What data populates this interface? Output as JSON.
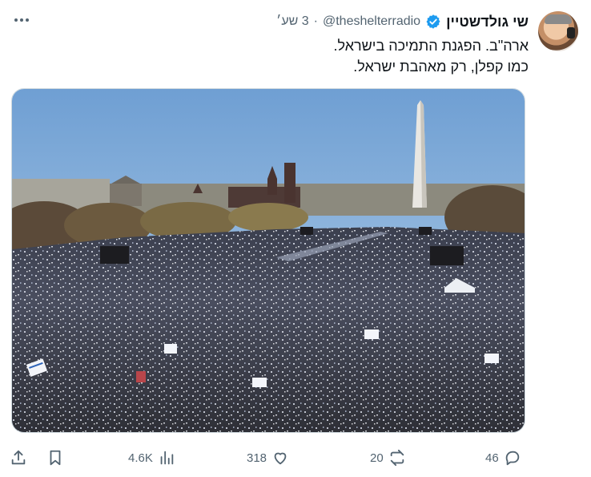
{
  "tweet": {
    "author_name": "שי גולדשטיין",
    "handle": "@theshelterradio",
    "separator": "·",
    "time": "3 שע׳",
    "text_lines": [
      "ארה\"ב. הפגנת התמיכה בישראל.",
      "כמו קפלן, רק מאהבת ישראל."
    ],
    "image_description": "aerial photo of a huge crowd with Israeli flags on the National Mall"
  },
  "metrics": {
    "replies": "46",
    "retweets": "20",
    "likes": "318",
    "views": "4.6K"
  },
  "colors": {
    "text": "#0f1419",
    "secondary": "#536471",
    "verified": "#1d9bf0",
    "border": "#cfd9de"
  },
  "icons": {
    "verified": "verified-badge-icon",
    "more": "more-dots-icon",
    "reply": "reply-icon",
    "retweet": "retweet-icon",
    "like": "heart-icon",
    "views": "views-bar-icon",
    "bookmark": "bookmark-icon",
    "share": "share-icon"
  }
}
